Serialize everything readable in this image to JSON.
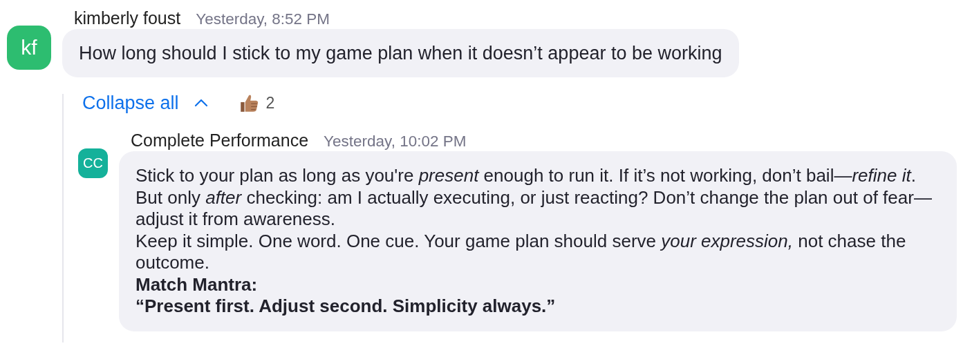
{
  "message": {
    "avatar_initials": "kf",
    "color": "#2dbd70",
    "author": "kimberly foust",
    "time": "Yesterday, 8:52 PM",
    "text": "How long should I stick to my game plan when it doesn’t appear to be working"
  },
  "thread": {
    "collapse_label": "Collapse all",
    "expanded": true,
    "reaction": {
      "count": "2"
    }
  },
  "reply": {
    "avatar_initials": "CC",
    "color": "#14b19a",
    "author": "Complete Performance",
    "time": "Yesterday, 10:02 PM",
    "lines": [
      {
        "kind": "text",
        "text": "Stick to your plan as long as you're *present* enough to run it. If it’s not working, don’t bail—*refine it*. But only *after* checking: am I actually executing, or just reacting? Don’t change the plan out of fear—adjust it from awareness."
      },
      {
        "kind": "text",
        "text": "Keep it simple. One word. One cue. Your game plan should serve *your expression,* not chase the outcome."
      },
      {
        "kind": "bold",
        "text": "Match Mantra:"
      },
      {
        "kind": "bold",
        "text": "“Present first. Adjust second. Simplicity always.”"
      }
    ]
  }
}
